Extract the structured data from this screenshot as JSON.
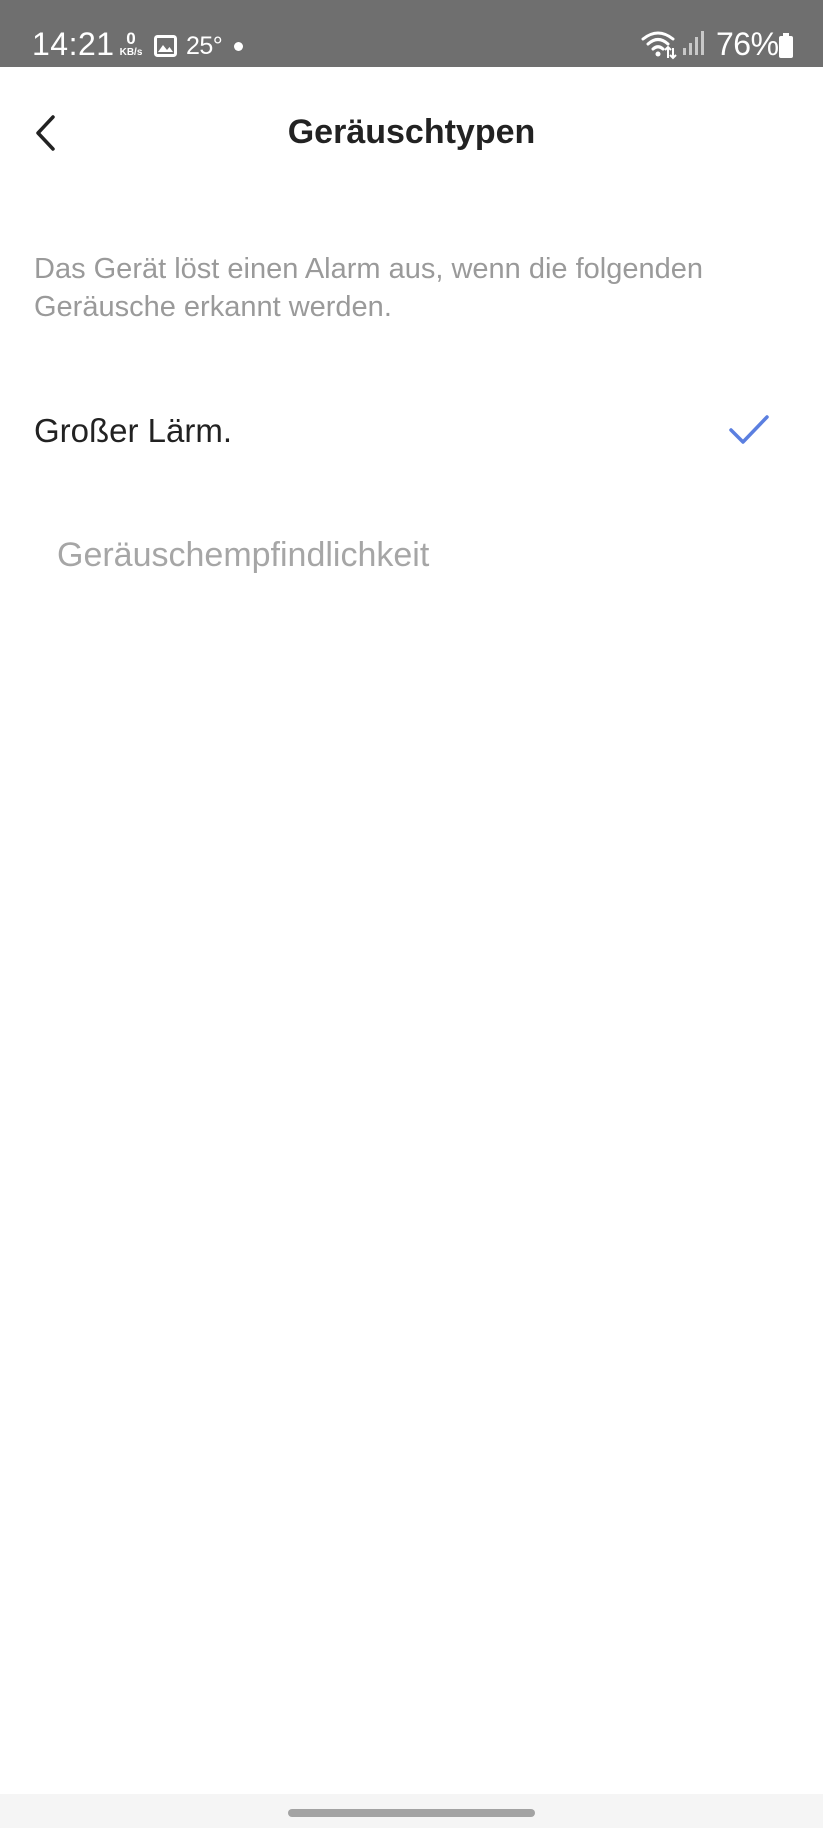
{
  "status_bar": {
    "time": "14:21",
    "net_speed_value": "0",
    "net_speed_unit": "KB/s",
    "temperature": "25°",
    "battery_percent": "76%",
    "icons": [
      "image-icon",
      "dot-icon",
      "wifi-icon",
      "signal-icon",
      "battery-icon"
    ]
  },
  "header": {
    "title": "Geräuschtypen",
    "back_icon": "chevron-left-icon"
  },
  "description": "Das Gerät löst einen Alarm aus, wenn die folgenden Geräusche erkannt werden.",
  "options": [
    {
      "label": "Großer Lärm.",
      "selected": true,
      "icon": "check-icon"
    }
  ],
  "sensitivity": {
    "label": "Geräuschempfindlichkeit"
  },
  "colors": {
    "status_bar_bg": "#6f6f6f",
    "accent": "#5b7fe0",
    "primary_text": "#222222",
    "secondary_text": "#9a9a9a",
    "nav_bar_bg": "#f5f5f5"
  }
}
